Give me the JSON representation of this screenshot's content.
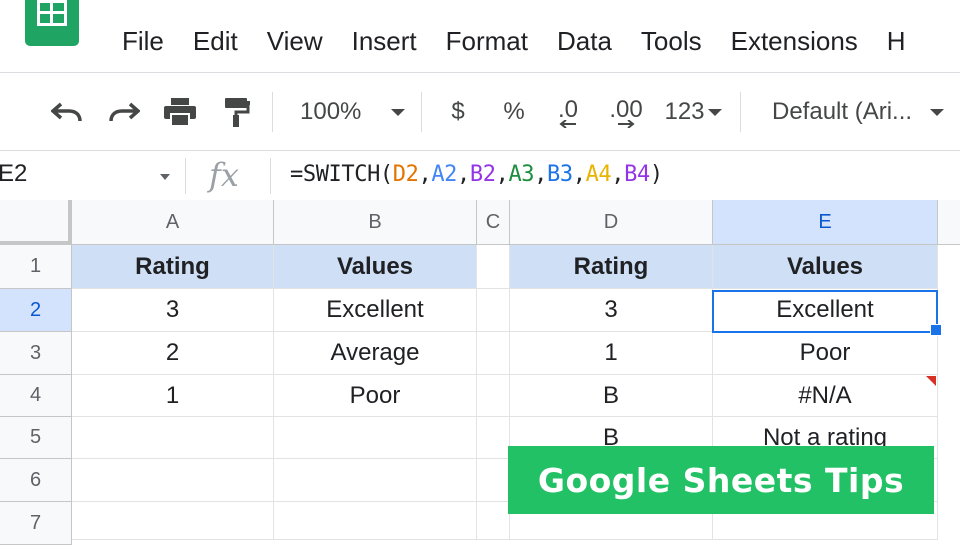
{
  "app": {
    "icon": "google-sheets-icon",
    "brand_color": "#1fa463"
  },
  "menu": [
    "File",
    "Edit",
    "View",
    "Insert",
    "Format",
    "Data",
    "Tools",
    "Extensions",
    "H"
  ],
  "toolbar": {
    "zoom": "100%",
    "currency": "$",
    "percent": "%",
    "decrease_decimals": ".0",
    "increase_decimals": ".00",
    "more_formats": "123",
    "font": "Default (Ari..."
  },
  "formula_bar": {
    "name_box": "E2",
    "fx_label": "fx",
    "formula_parts": [
      {
        "text": "=SWITCH(",
        "color": "#202124"
      },
      {
        "text": "D2",
        "color": "#e37400"
      },
      {
        "text": ",",
        "color": "#202124"
      },
      {
        "text": "A2",
        "color": "#4285f4"
      },
      {
        "text": ",",
        "color": "#202124"
      },
      {
        "text": "B2",
        "color": "#9334e6"
      },
      {
        "text": ",",
        "color": "#202124"
      },
      {
        "text": "A3",
        "color": "#1e8e3e"
      },
      {
        "text": ",",
        "color": "#202124"
      },
      {
        "text": "B3",
        "color": "#1a73e8"
      },
      {
        "text": ",",
        "color": "#202124"
      },
      {
        "text": "A4",
        "color": "#e8b400"
      },
      {
        "text": ",",
        "color": "#202124"
      },
      {
        "text": "B4",
        "color": "#9334e6"
      },
      {
        "text": ")",
        "color": "#202124"
      }
    ]
  },
  "grid": {
    "columns": [
      "A",
      "B",
      "C",
      "D",
      "E"
    ],
    "rows": [
      "1",
      "2",
      "3",
      "4",
      "5",
      "6",
      "7"
    ],
    "active_cell": "E2",
    "cells": {
      "A1": "Rating",
      "B1": "Values",
      "D1": "Rating",
      "E1": "Values",
      "A2": "3",
      "B2": "Excellent",
      "D2": "3",
      "E2": "Excellent",
      "A3": "2",
      "B3": "Average",
      "D3": "1",
      "E3": "Poor",
      "A4": "1",
      "B4": "Poor",
      "D4": "B",
      "E4": "#N/A",
      "D5": "B",
      "E5": "Not a rating"
    },
    "header_fill": "#cfe0f6"
  },
  "banner": {
    "text": "Google Sheets Tips",
    "color": "#23c165"
  }
}
